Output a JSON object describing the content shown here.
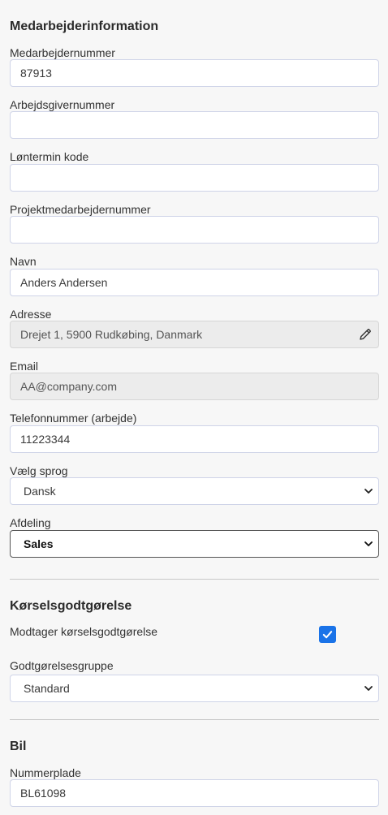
{
  "employee_info": {
    "title": "Medarbejderinformation",
    "employee_number": {
      "label": "Medarbejdernummer",
      "value": "87913"
    },
    "employer_number": {
      "label": "Arbejdsgivernummer",
      "value": ""
    },
    "pay_period_code": {
      "label": "Løntermin kode",
      "value": ""
    },
    "project_employee_number": {
      "label": "Projektmedarbejdernummer",
      "value": ""
    },
    "name": {
      "label": "Navn",
      "value": "Anders Andersen"
    },
    "address": {
      "label": "Adresse",
      "value": "Drejet 1, 5900 Rudkøbing, Danmark",
      "icon": "pencil-icon"
    },
    "email": {
      "label": "Email",
      "value": "AA@company.com"
    },
    "work_phone": {
      "label": "Telefonnummer (arbejde)",
      "value": "11223344"
    },
    "language": {
      "label": "Vælg sprog",
      "value": "Dansk"
    },
    "department": {
      "label": "Afdeling",
      "value": "Sales"
    }
  },
  "mileage": {
    "title": "Kørselsgodtgørelse",
    "receives": {
      "label": "Modtager kørselsgodtgørelse",
      "checked": true
    },
    "group": {
      "label": "Godtgørelsesgruppe",
      "value": "Standard"
    }
  },
  "car": {
    "title": "Bil",
    "plate": {
      "label": "Nummerplade",
      "value": "BL61098"
    }
  },
  "colors": {
    "accent": "#1a73e8",
    "background": "#f7f7f7",
    "field_border": "#cfd4e8",
    "readonly_bg": "#ececec"
  }
}
